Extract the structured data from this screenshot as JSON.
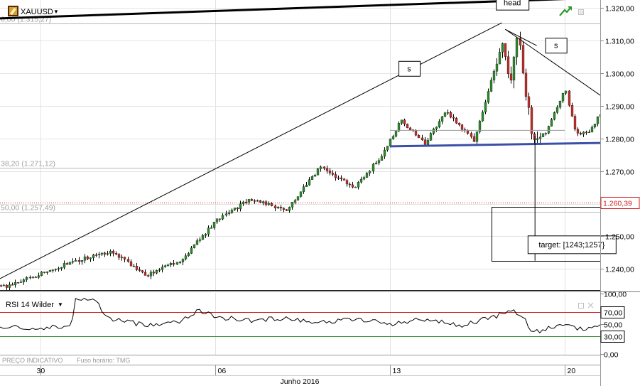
{
  "toolbar": {
    "symbol": "XAUUSD",
    "dropdown_glyph": "▼",
    "logo_icon": "gold-bars-icon",
    "trend_icon": "trend-arrow-icon"
  },
  "colors": {
    "bull_candle": "#2e8b2e",
    "bear_candle": "#c0302a",
    "wick": "#000000",
    "neckline": "#3a4fa8",
    "last_price_line": "#d02020",
    "rsi_line": "#000000",
    "rsi_upper_line": "#d02020",
    "rsi_lower_line": "#2e8b2e",
    "fib_line": "#b8b8b8",
    "grid": "#e3e3e3"
  },
  "chart_data": [
    {
      "type": "candlestick",
      "symbol": "XAUUSD",
      "x_unit": "session",
      "y_ticks": [
        1.24,
        1.25,
        1.26,
        1.27,
        1.28,
        1.29,
        1.3,
        1.31,
        1.32
      ],
      "y_tick_labels": [
        "1.240,00",
        "1.250,00",
        "1.260,00",
        "1.270,00",
        "1.280,00",
        "1.290,00",
        "1.300,00",
        "1.310,00",
        "1.320,00"
      ],
      "ylim": [
        1.2335,
        1.3225
      ],
      "x_ticks": [
        {
          "label": "30",
          "session": 0
        },
        {
          "label": "06",
          "session": 5
        },
        {
          "label": "13",
          "session": 10
        },
        {
          "label": "20",
          "session": 15
        }
      ],
      "month_label": "Junho 2016",
      "key_closes": [
        {
          "session": -1,
          "close": 1.2345
        },
        {
          "session": 1,
          "close": 1.2425
        },
        {
          "session": 2,
          "close": 1.2455
        },
        {
          "session": 3,
          "close": 1.238
        },
        {
          "session": 4,
          "close": 1.2425
        },
        {
          "session": 5,
          "close": 1.2545
        },
        {
          "session": 6,
          "close": 1.2615
        },
        {
          "session": 7,
          "close": 1.258
        },
        {
          "session": 8,
          "close": 1.271
        },
        {
          "session": 9,
          "close": 1.265
        },
        {
          "session": 9.8,
          "close": 1.2755
        },
        {
          "session": 10.3,
          "close": 1.2855
        },
        {
          "session": 11,
          "close": 1.2785
        },
        {
          "session": 11.6,
          "close": 1.2885
        },
        {
          "session": 12.4,
          "close": 1.279
        },
        {
          "session": 13.2,
          "close": 1.3095
        },
        {
          "session": 13.45,
          "close": 1.2975
        },
        {
          "session": 13.65,
          "close": 1.3135
        },
        {
          "session": 13.8,
          "close": 1.2995
        },
        {
          "session": 14.1,
          "close": 1.2785
        },
        {
          "session": 14.5,
          "close": 1.2825
        },
        {
          "session": 15,
          "close": 1.2955
        },
        {
          "session": 15.3,
          "close": 1.2815
        },
        {
          "session": 15.7,
          "close": 1.2815
        },
        {
          "session": 16.2,
          "close": 1.2915
        },
        {
          "session": 16.6,
          "close": 1.2835
        },
        {
          "session": 17,
          "close": 1.2775
        },
        {
          "session": 17.3,
          "close": 1.2685
        },
        {
          "session": 18,
          "close": 1.2665
        },
        {
          "session": 18.6,
          "close": 1.2655
        },
        {
          "session": 19.1,
          "close": 1.265
        },
        {
          "session": 19.4,
          "close": 1.2695
        },
        {
          "session": 19.7,
          "close": 1.2605
        }
      ],
      "last_price": {
        "value": 1.26039,
        "label": "1.260,39"
      },
      "fibonacci_levels": [
        {
          "label": "0,00 (1.315,27)",
          "value": 1.31527
        },
        {
          "label": "38,20 (1.271,12)",
          "value": 1.27112
        },
        {
          "label": "50,00 (1.257,49)",
          "value": 1.25749
        }
      ],
      "annotations": {
        "head": "head",
        "left_shoulder": "s",
        "right_shoulder": "s",
        "target": "target: [1243;1257}"
      },
      "trendlines": [
        {
          "name": "rising-support-line",
          "from": {
            "session": -1.8,
            "value": 1.2335
          },
          "to": {
            "session": 13.2,
            "value": 1.3155
          }
        },
        {
          "name": "head-left-line",
          "from": {
            "session": 13.3,
            "value": 1.3135
          },
          "to": {
            "session": 14.2,
            "value": 1.3085
          }
        },
        {
          "name": "descending-shoulder-line",
          "from": {
            "session": 13.3,
            "value": 1.3135
          },
          "to": {
            "session": 17.8,
            "value": 1.28
          }
        },
        {
          "name": "neckline",
          "from": {
            "session": 10.0,
            "value": 1.2776
          },
          "to": {
            "session": 17.0,
            "value": 1.2788
          }
        },
        {
          "name": "neckline-guide",
          "from": {
            "session": 10.0,
            "value": 1.2825
          },
          "to": {
            "session": 15.0,
            "value": 1.2825
          }
        },
        {
          "name": "projection-line",
          "from": {
            "session": 14.15,
            "value": 1.2808
          },
          "to": {
            "session": 14.15,
            "value": 1.2425
          }
        },
        {
          "name": "upper-channel-line",
          "from": {
            "session": -3.5,
            "value": 1.316
          },
          "to": {
            "session": 19.6,
            "value": 1.3245
          }
        }
      ],
      "target_zone": {
        "session_from": 12.9,
        "session_to": 20.3,
        "high": 1.259,
        "low": 1.2425
      }
    },
    {
      "type": "line",
      "title": "RSI 14 Wilder",
      "y_ticks": [
        0,
        30,
        50,
        70,
        100
      ],
      "y_tick_labels": [
        "0,00",
        "30,00",
        "50,00",
        "70,00",
        "100,00"
      ],
      "ylim": [
        0,
        100
      ],
      "levels": [
        {
          "label": "70,00",
          "value": 70
        },
        {
          "label": "30,00",
          "value": 30
        }
      ],
      "key_values": [
        {
          "session": -1.8,
          "value": 48
        },
        {
          "session": -1,
          "value": 44
        },
        {
          "session": 0,
          "value": 43
        },
        {
          "session": 0.5,
          "value": 45
        },
        {
          "session": 0.9,
          "value": 48
        },
        {
          "session": 1,
          "value": 90
        },
        {
          "session": 1.5,
          "value": 91
        },
        {
          "session": 2,
          "value": 58
        },
        {
          "session": 3,
          "value": 48
        },
        {
          "session": 4,
          "value": 55
        },
        {
          "session": 4.5,
          "value": 72
        },
        {
          "session": 5,
          "value": 62
        },
        {
          "session": 6,
          "value": 55
        },
        {
          "session": 7,
          "value": 60
        },
        {
          "session": 8,
          "value": 52
        },
        {
          "session": 9,
          "value": 58
        },
        {
          "session": 10,
          "value": 50
        },
        {
          "session": 11,
          "value": 58
        },
        {
          "session": 12,
          "value": 47
        },
        {
          "session": 13,
          "value": 62
        },
        {
          "session": 13.5,
          "value": 72
        },
        {
          "session": 13.8,
          "value": 62
        },
        {
          "session": 14.1,
          "value": 35
        },
        {
          "session": 15,
          "value": 50
        },
        {
          "session": 15.5,
          "value": 41
        },
        {
          "session": 16.3,
          "value": 49
        },
        {
          "session": 17,
          "value": 36
        },
        {
          "session": 17.5,
          "value": 29
        },
        {
          "session": 18,
          "value": 34
        },
        {
          "session": 19,
          "value": 38
        },
        {
          "session": 19.4,
          "value": 51
        },
        {
          "session": 19.6,
          "value": 41
        }
      ]
    }
  ],
  "footer": {
    "quote_type": "PREÇO INDICATIVO",
    "timezone": "Fuso horário: TMG"
  }
}
